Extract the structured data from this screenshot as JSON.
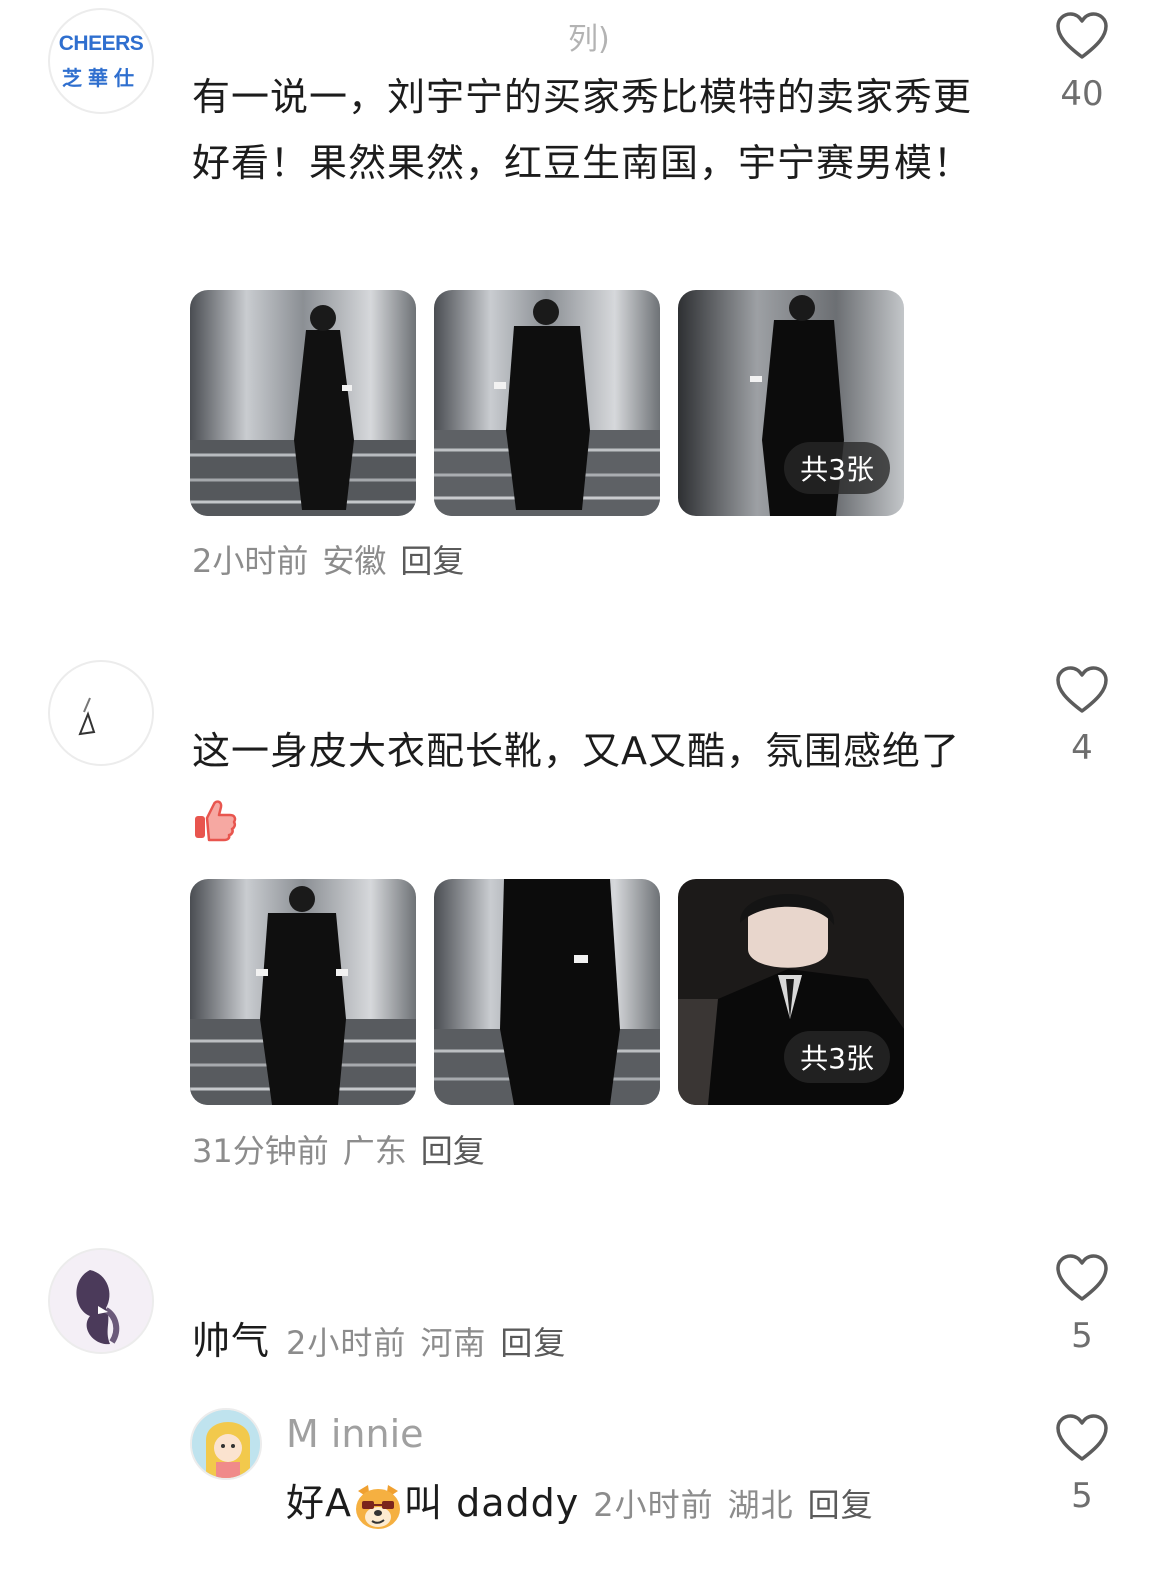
{
  "comments": [
    {
      "username": "列)",
      "avatar_text_top": "CHEERS",
      "avatar_text_bottom": "芝華仕",
      "text": "有一说一，刘宇宁的买家秀比模特的卖家秀更好看！果然果然，红豆生南国，宇宁赛男模！",
      "likes": "40",
      "photo_count_label": "共3张",
      "time": "2小时前",
      "location": "安徽",
      "reply_label": "回复"
    },
    {
      "username": "",
      "text": "这一身皮大衣配长靴，又A又酷，氛围感绝了",
      "emoji": "thumbs-up",
      "likes": "4",
      "photo_count_label": "共3张",
      "time": "31分钟前",
      "location": "广东",
      "reply_label": "回复"
    },
    {
      "username": "",
      "text": "帅气",
      "likes": "5",
      "time": "2小时前",
      "location": "河南",
      "reply_label": "回复"
    }
  ],
  "reply": {
    "username": "M innie",
    "text_before": "好A",
    "emoji": "smug-dog-face",
    "text_after": "叫 daddy",
    "likes": "5",
    "time": "2小时前",
    "location": "湖北",
    "reply_label": "回复"
  },
  "colors": {
    "brand_blue": "#2f6fcf",
    "meta_gray": "#8c8c8c",
    "text": "#1c1c1c",
    "badge_bg": "#282828"
  }
}
